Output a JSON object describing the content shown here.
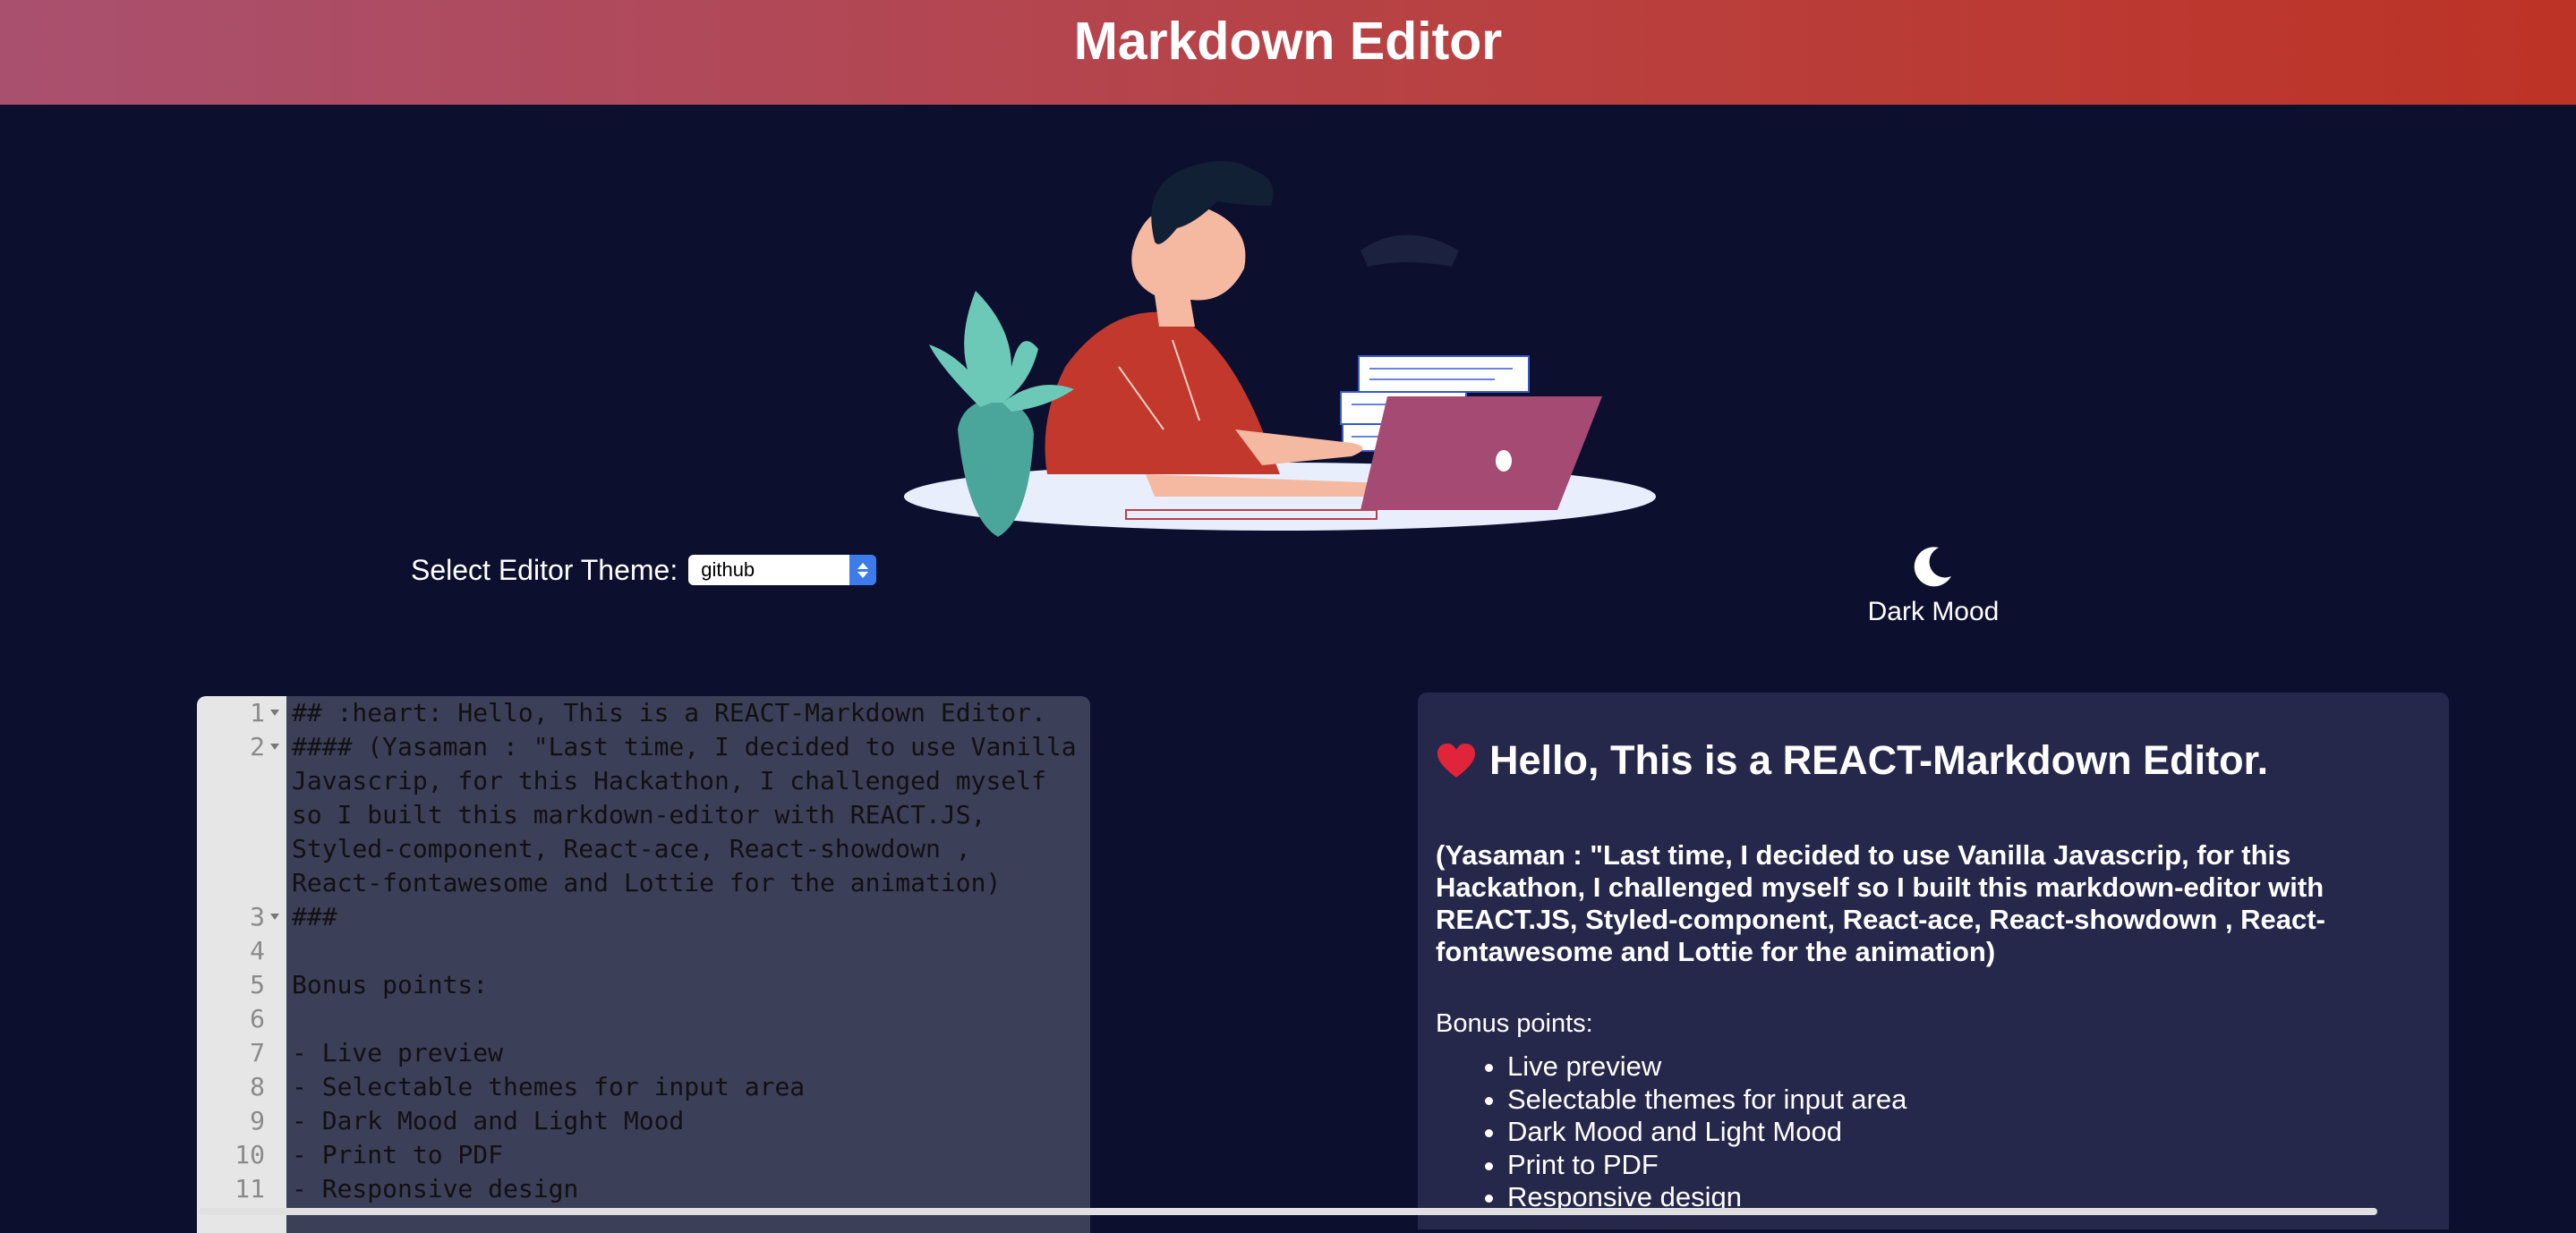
{
  "header": {
    "title": "Markdown Editor"
  },
  "controls": {
    "theme_label": "Select Editor Theme:",
    "theme_value": "github",
    "mood_label": "Dark Mood",
    "mood_icon": "moon-icon"
  },
  "editor": {
    "lines": [
      {
        "num": "1",
        "text": "## :heart: Hello, This is a REACT-Markdown Editor."
      },
      {
        "num": "2",
        "text": "#### (Yasaman : \"Last time, I decided to use Vanilla"
      },
      {
        "num": "",
        "text": "Javascrip, for this Hackathon, I challenged myself"
      },
      {
        "num": "",
        "text": "so I built this markdown-editor with REACT.JS,"
      },
      {
        "num": "",
        "text": "Styled-component, React-ace, React-showdown ,"
      },
      {
        "num": "",
        "text": "React-fontawesome and Lottie for the animation)"
      },
      {
        "num": "3",
        "text": "###"
      },
      {
        "num": "4",
        "text": ""
      },
      {
        "num": "5",
        "text": "Bonus points:"
      },
      {
        "num": "6",
        "text": ""
      },
      {
        "num": "7",
        "text": "- Live preview"
      },
      {
        "num": "8",
        "text": "- Selectable themes for input area"
      },
      {
        "num": "9",
        "text": "- Dark Mood and Light Mood"
      },
      {
        "num": "10",
        "text": "- Print to PDF"
      },
      {
        "num": "11",
        "text": "- Responsive design"
      }
    ]
  },
  "preview": {
    "heading": "Hello, This is a REACT-Markdown Editor.",
    "subheading": "(Yasaman : \"Last time, I decided to use Vanilla Javascrip, for this Hackathon, I challenged myself so I built this markdown-editor with REACT.JS, Styled-component, React-ace, React-showdown , React-fontawesome and Lottie for the animation)",
    "paragraph": "Bonus points:",
    "bullets": [
      "Live preview",
      "Selectable themes for input area",
      "Dark Mood and Light Mood",
      "Print to PDF",
      "Responsive design"
    ]
  }
}
